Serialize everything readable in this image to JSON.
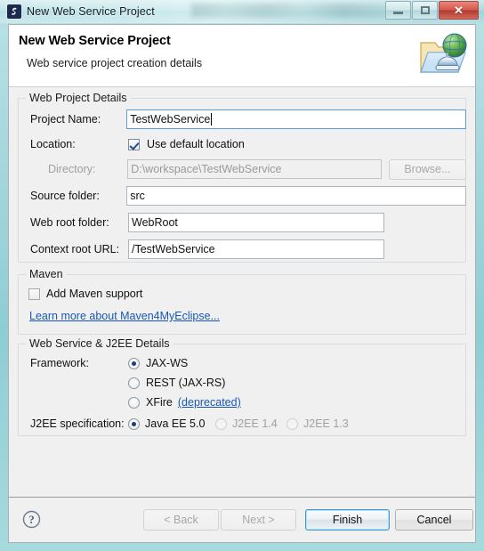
{
  "window": {
    "title": "New Web Service Project",
    "icon": "myeclipse-logo-icon",
    "controls": {
      "minimize": "minimize-button",
      "maximize": "maximize-button",
      "close": "close-button"
    }
  },
  "banner": {
    "title": "New Web Service Project",
    "subtitle": "Web service project creation details",
    "icon": "web-service-project-folder-globe-icon"
  },
  "web_project_details": {
    "legend": "Web Project Details",
    "project_name_label": "Project Name:",
    "project_name_value": "TestWebService",
    "location_label": "Location:",
    "use_default_location_label": "Use default location",
    "use_default_location_checked": true,
    "directory_label": "Directory:",
    "directory_value": "D:\\workspace\\TestWebService",
    "browse_label": "Browse...",
    "source_folder_label": "Source folder:",
    "source_folder_value": "src",
    "web_root_folder_label": "Web root folder:",
    "web_root_folder_value": "WebRoot",
    "context_root_label": "Context root URL:",
    "context_root_value": "/TestWebService"
  },
  "maven": {
    "legend": "Maven",
    "add_maven_support_label": "Add Maven support",
    "add_maven_support_checked": false,
    "learn_more_link": "Learn more about Maven4MyEclipse..."
  },
  "web_service_j2ee": {
    "legend": "Web Service & J2EE Details",
    "framework_label": "Framework:",
    "frameworks": [
      {
        "label": "JAX-WS",
        "selected": true,
        "enabled": true,
        "suffix": ""
      },
      {
        "label": "REST (JAX-RS)",
        "selected": false,
        "enabled": true,
        "suffix": ""
      },
      {
        "label": "XFire",
        "selected": false,
        "enabled": true,
        "suffix": "(deprecated)"
      }
    ],
    "j2ee_spec_label": "J2EE specification:",
    "j2ee_specs": [
      {
        "label": "Java EE 5.0",
        "selected": true,
        "enabled": true
      },
      {
        "label": "J2EE 1.4",
        "selected": false,
        "enabled": false
      },
      {
        "label": "J2EE 1.3",
        "selected": false,
        "enabled": false
      }
    ]
  },
  "footer": {
    "help_icon": "help-question-icon",
    "back_label": "< Back",
    "next_label": "Next >",
    "finish_label": "Finish",
    "cancel_label": "Cancel"
  },
  "colors": {
    "frame": "#9ed4da",
    "accent_focus": "#3c9ad6",
    "link": "#1758b5",
    "close_button": "#d6584c"
  }
}
